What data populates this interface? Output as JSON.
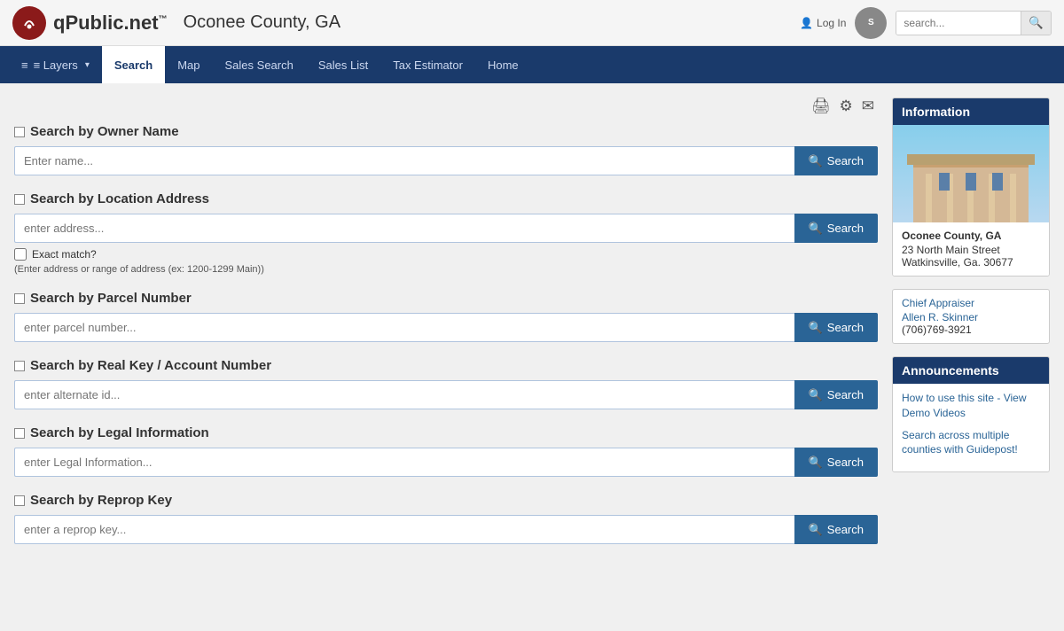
{
  "header": {
    "logo_text": "qPublic.net",
    "logo_tm": "™",
    "county": "Oconee County, GA",
    "login_label": "Log In",
    "search_placeholder": "search...",
    "schneider_label": "S"
  },
  "nav": {
    "layers_label": "≡ Layers",
    "items": [
      {
        "id": "search",
        "label": "Search",
        "active": true
      },
      {
        "id": "map",
        "label": "Map",
        "active": false
      },
      {
        "id": "sales-search",
        "label": "Sales Search",
        "active": false
      },
      {
        "id": "sales-list",
        "label": "Sales List",
        "active": false
      },
      {
        "id": "tax-estimator",
        "label": "Tax Estimator",
        "active": false
      },
      {
        "id": "home",
        "label": "Home",
        "active": false
      }
    ]
  },
  "toolbar": {
    "print_icon": "🖨",
    "settings_icon": "⚙",
    "mail_icon": "✉"
  },
  "search_sections": [
    {
      "id": "owner-name",
      "title": "Search by Owner Name",
      "placeholder": "Enter name...",
      "search_label": "Search",
      "extras": []
    },
    {
      "id": "location-address",
      "title": "Search by Location Address",
      "placeholder": "enter address...",
      "search_label": "Search",
      "extras": [
        "exact_match",
        "address_hint"
      ]
    },
    {
      "id": "parcel-number",
      "title": "Search by Parcel Number",
      "placeholder": "enter parcel number...",
      "search_label": "Search",
      "extras": []
    },
    {
      "id": "real-key",
      "title": "Search by Real Key / Account Number",
      "placeholder": "enter alternate id...",
      "search_label": "Search",
      "extras": []
    },
    {
      "id": "legal-information",
      "title": "Search by Legal Information",
      "placeholder": "enter Legal Information...",
      "search_label": "Search",
      "extras": []
    },
    {
      "id": "reprop-key",
      "title": "Search by Reprop Key",
      "placeholder": "enter a reprop key...",
      "search_label": "Search",
      "extras": []
    }
  ],
  "exact_match_label": "Exact match?",
  "address_hint": "(Enter address or range of address (ex: 1200-1299 Main))",
  "sidebar": {
    "info_title": "Information",
    "county_name": "Oconee County, GA",
    "county_address1": "23 North Main Street",
    "county_address2": "Watkinsville, Ga. 30677",
    "chief_appraiser_label": "Chief Appraiser",
    "appraiser_name": "Allen R. Skinner",
    "appraiser_phone": "(706)769-3921",
    "announcements_title": "Announcements",
    "announcement_links": [
      "How to use this site - View Demo Videos",
      "Search across multiple counties with Guidepost!"
    ]
  }
}
